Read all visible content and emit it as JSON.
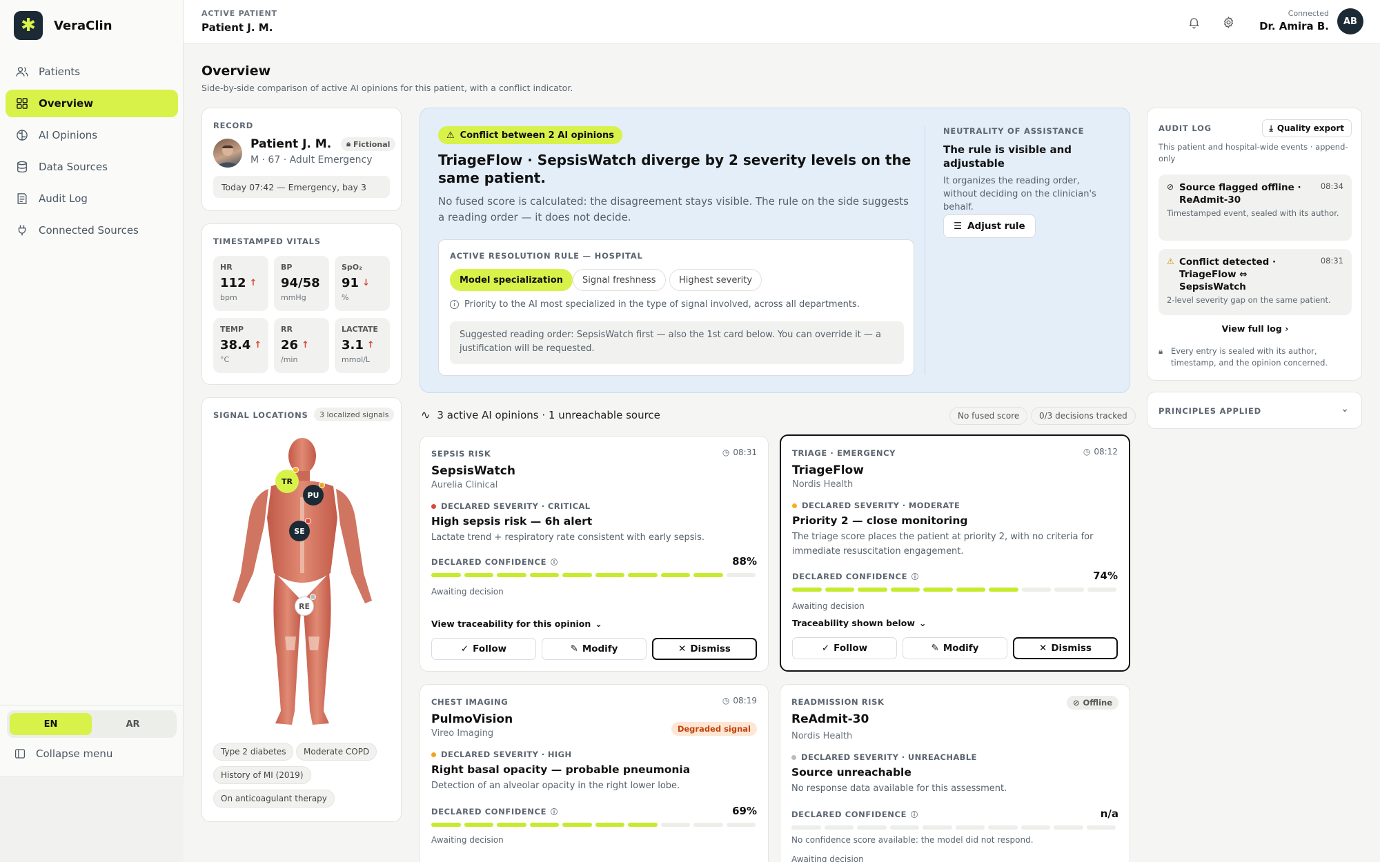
{
  "brand": {
    "name": "VeraClin",
    "logo_glyph": "✱"
  },
  "nav": [
    {
      "label": "Patients",
      "icon": "users-icon"
    },
    {
      "label": "Overview",
      "icon": "grid-icon",
      "active": true
    },
    {
      "label": "AI Opinions",
      "icon": "brain-icon"
    },
    {
      "label": "Data Sources",
      "icon": "database-icon"
    },
    {
      "label": "Audit Log",
      "icon": "log-icon"
    },
    {
      "label": "Connected Sources",
      "icon": "plug-icon"
    }
  ],
  "lang": {
    "en": "EN",
    "ar": "AR",
    "active": "EN"
  },
  "collapse_label": "Collapse menu",
  "header": {
    "label": "ACTIVE PATIENT",
    "patient": "Patient J. M.",
    "connected": "Connected",
    "user": "Dr. Amira B.",
    "initials": "AB"
  },
  "page": {
    "title": "Overview",
    "subtitle": "Side-by-side comparison of active AI opinions for this patient, with a conflict indicator."
  },
  "record": {
    "caption": "RECORD",
    "name": "Patient J. M.",
    "badge": "Fictional",
    "meta": "M · 67 · Adult Emergency",
    "time": "Today 07:42 — Emergency, bay 3"
  },
  "vitals": {
    "caption": "TIMESTAMPED VITALS",
    "items": [
      {
        "label": "HR",
        "value": "112",
        "trend": "↑",
        "unit": "bpm"
      },
      {
        "label": "BP",
        "value": "94/58",
        "trend": "",
        "unit": "mmHg"
      },
      {
        "label": "SpO₂",
        "value": "91",
        "trend": "↓",
        "unit": "%"
      },
      {
        "label": "TEMP",
        "value": "38.4",
        "trend": "↑",
        "unit": "°C"
      },
      {
        "label": "RR",
        "value": "26",
        "trend": "↑",
        "unit": "/min"
      },
      {
        "label": "LACTATE",
        "value": "3.1",
        "trend": "↑",
        "unit": "mmol/L"
      }
    ]
  },
  "signals": {
    "caption": "SIGNAL LOCATIONS",
    "badge": "3 localized signals",
    "pins": [
      "TR",
      "PU",
      "SE",
      "RE"
    ],
    "conditions": [
      "Type 2 diabetes",
      "Moderate COPD",
      "History of MI (2019)",
      "On anticoagulant therapy"
    ]
  },
  "conflict": {
    "badge": "Conflict between 2 AI opinions",
    "title": "TriageFlow · SepsisWatch diverge by 2 severity levels on the same patient.",
    "desc": "No fused score is calculated: the disagreement stays visible. The rule on the side suggests a reading order — it does not decide.",
    "rule_caption": "ACTIVE RESOLUTION RULE — HOSPITAL",
    "rules": [
      "Model specialization",
      "Signal freshness",
      "Highest severity"
    ],
    "rule_info": "Priority to the AI most specialized in the type of signal involved, across all departments.",
    "suggestion": "Suggested reading order: SepsisWatch first — also the 1st card below. You can override it — a justification will be requested.",
    "neutral_caption": "NEUTRALITY OF ASSISTANCE",
    "neutral_title": "The rule is visible and adjustable",
    "neutral_desc": "It organizes the reading order, without deciding on the clinician's behalf.",
    "adjust_label": "Adjust rule"
  },
  "opinions_header": {
    "summary": "3 active AI opinions · 1 unreachable source",
    "tag_fused": "No fused score",
    "tag_tracked": "0/3 decisions tracked"
  },
  "labels": {
    "declared_confidence": "DECLARED CONFIDENCE",
    "awaiting": "Awaiting decision",
    "follow": "Follow",
    "modify": "Modify",
    "dismiss": "Dismiss"
  },
  "opinions": [
    {
      "caption": "SEPSIS RISK",
      "time": "08:31",
      "name": "SepsisWatch",
      "vendor": "Aurelia Clinical",
      "severity": "DECLARED SEVERITY · CRITICAL",
      "severity_color": "#e0473a",
      "headline": "High sepsis risk — 6h alert",
      "desc": "Lactate trend + respiratory rate consistent with early sepsis.",
      "confidence": "88%",
      "confidence_value": 88,
      "trace": "View traceability for this opinion"
    },
    {
      "caption": "TRIAGE · EMERGENCY",
      "time": "08:12",
      "name": "TriageFlow",
      "vendor": "Nordis Health",
      "severity": "DECLARED SEVERITY · MODERATE",
      "severity_color": "#f2b11c",
      "headline": "Priority 2 — close monitoring",
      "desc": "The triage score places the patient at priority 2, with no criteria for immediate resuscitation engagement.",
      "confidence": "74%",
      "confidence_value": 74,
      "trace": "Traceability shown below"
    },
    {
      "caption": "CHEST IMAGING",
      "time": "08:19",
      "name": "PulmoVision",
      "vendor": "Vireo Imaging",
      "badge": "Degraded signal",
      "severity": "DECLARED SEVERITY · HIGH",
      "severity_color": "#f2a31c",
      "headline": "Right basal opacity — probable pneumonia",
      "desc": "Detection of an alveolar opacity in the right lower lobe.",
      "confidence": "69%",
      "confidence_value": 69
    },
    {
      "caption": "READMISSION RISK",
      "status": "Offline",
      "name": "ReAdmit-30",
      "vendor": "Nordis Health",
      "severity": "DECLARED SEVERITY · UNREACHABLE",
      "severity_color": "#b8bcc0",
      "headline": "Source unreachable",
      "desc": "No response data available for this assessment.",
      "confidence": "n/a",
      "confidence_value": 0,
      "no_conf_note": "No confidence score available: the model did not respond."
    }
  ],
  "audit": {
    "caption": "AUDIT LOG",
    "export_label": "Quality export",
    "sub": "This patient and hospital-wide events · append-only",
    "events": [
      {
        "title": "Source flagged offline · ReAdmit-30",
        "time": "08:34",
        "desc": "Timestamped event, sealed with its author.",
        "icon": "offline-icon"
      },
      {
        "title": "Conflict detected · TriageFlow ⇔ SepsisWatch",
        "time": "08:31",
        "desc": "2-level severity gap on the same patient.",
        "icon": "warning-icon"
      }
    ],
    "view_full": "View full log",
    "foot": "Every entry is sealed with its author, timestamp, and the opinion concerned."
  },
  "principles": {
    "caption": "PRINCIPLES APPLIED"
  },
  "colors": {
    "accent": "#d8f24a",
    "dark": "#1b2a35",
    "conflict_bg": "#e3eef9"
  }
}
